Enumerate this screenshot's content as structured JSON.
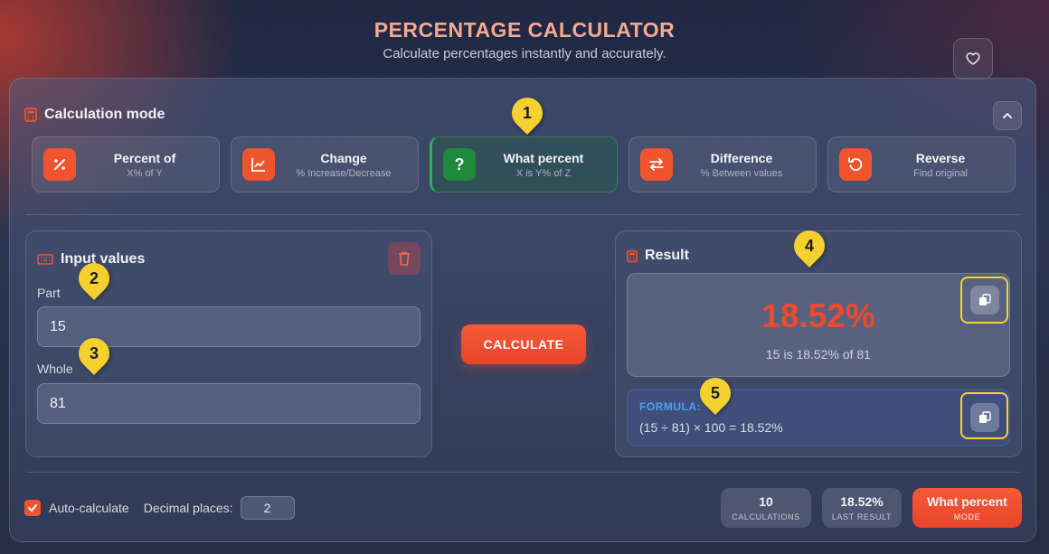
{
  "app": {
    "title": "PERCENTAGE CALCULATOR",
    "subtitle": "Calculate percentages instantly and accurately."
  },
  "mode_section": {
    "title": "Calculation mode",
    "modes": [
      {
        "label": "Percent of",
        "sub": "X% of Y",
        "icon": "percent-icon"
      },
      {
        "label": "Change",
        "sub": "% Increase/Decrease",
        "icon": "trend-chart-icon"
      },
      {
        "label": "What percent",
        "sub": "X is Y% of Z",
        "icon": "question-icon",
        "active": true
      },
      {
        "label": "Difference",
        "sub": "% Between values",
        "icon": "swap-arrows-icon"
      },
      {
        "label": "Reverse",
        "sub": "Find original",
        "icon": "undo-icon"
      }
    ]
  },
  "inputs": {
    "title": "Input values",
    "part_label": "Part",
    "part_value": "15",
    "whole_label": "Whole",
    "whole_value": "81"
  },
  "calculate_label": "CALCULATE",
  "result": {
    "title": "Result",
    "value": "18.52%",
    "description": "15 is 18.52% of 81",
    "formula_label": "FORMULA:",
    "formula": "(15 ÷ 81) × 100 = 18.52%"
  },
  "footer": {
    "auto_calculate_label": "Auto-calculate",
    "auto_calculate_checked": true,
    "decimal_label": "Decimal places:",
    "decimal_value": "2"
  },
  "stats": {
    "calculations_value": "10",
    "calculations_label": "CALCULATIONS",
    "last_result_value": "18.52%",
    "last_result_label": "LAST RESULT",
    "mode_value": "What percent",
    "mode_label": "MODE"
  },
  "markers": [
    "1",
    "2",
    "3",
    "4",
    "5"
  ],
  "colors": {
    "accent": "#f0542f",
    "active_mode": "#1f8a3b",
    "result_value": "#ee4a2c",
    "formula_label": "#4aa0f0",
    "marker": "#f5d130"
  }
}
